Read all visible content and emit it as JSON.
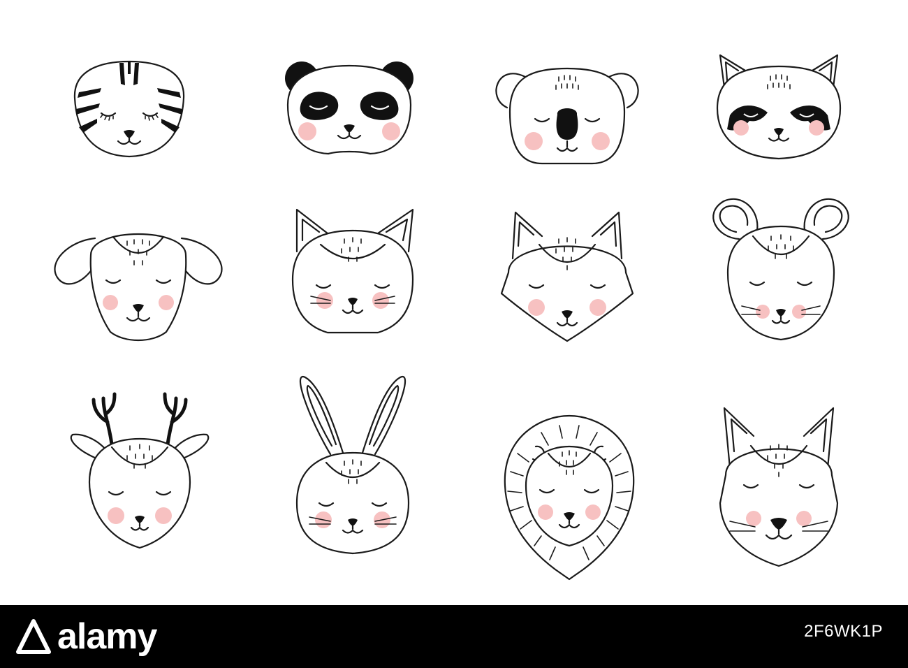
{
  "illustration": {
    "style": "black line-art animal faces with pink cheeks",
    "colors": {
      "line": "#1a1a1a",
      "cheek": "#f7c1c1",
      "background": "#ffffff"
    },
    "animals": [
      "tiger",
      "panda",
      "koala",
      "raccoon",
      "dog",
      "cat",
      "fox",
      "mouse",
      "deer",
      "rabbit",
      "lion",
      "wolf"
    ]
  },
  "footer": {
    "brand": "alamy",
    "image_id": "2F6WK1P",
    "background": "#000000"
  }
}
